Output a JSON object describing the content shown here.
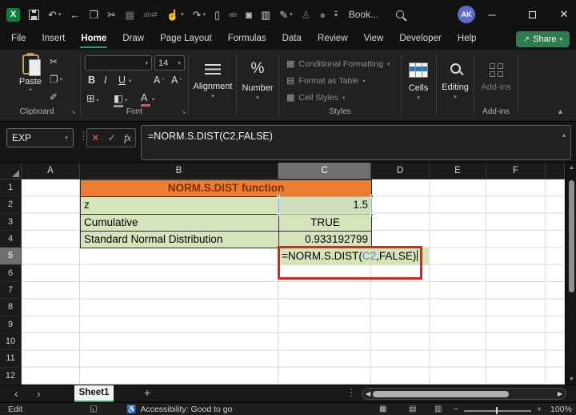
{
  "titlebar": {
    "title": "Book...",
    "avatar": "AK",
    "qat": [
      {
        "name": "excel-logo",
        "type": "logo"
      },
      {
        "name": "save-icon",
        "type": "floppy"
      },
      {
        "name": "undo-icon",
        "glyph": "↶",
        "chev": true
      },
      {
        "name": "back-icon",
        "glyph": "←"
      },
      {
        "name": "copy-icon",
        "glyph": "❐"
      },
      {
        "name": "cut-icon",
        "glyph": "✂"
      },
      {
        "name": "picture-icon",
        "glyph": "▦",
        "muted": true
      },
      {
        "name": "find-replace-icon",
        "glyph": "ab⇄",
        "muted": true,
        "small": true
      },
      {
        "name": "touch-mode-icon",
        "glyph": "☝",
        "chev": true
      },
      {
        "name": "redo-icon",
        "glyph": "↷",
        "chev": true
      },
      {
        "name": "new-file-icon",
        "glyph": "▯"
      },
      {
        "name": "strikethrough-icon",
        "glyph": "ab",
        "muted": true,
        "small": true,
        "strike": true
      },
      {
        "name": "camera-icon",
        "glyph": "◙"
      },
      {
        "name": "doc-preview-icon",
        "glyph": "▥"
      },
      {
        "name": "ink-pen-icon",
        "glyph": "✎",
        "chev": true
      },
      {
        "name": "permissions-icon",
        "glyph": "♙",
        "muted": true
      },
      {
        "name": "shape-circle-icon",
        "glyph": "●",
        "muted": true
      },
      {
        "name": "qat-overflow-icon",
        "glyph": "▾",
        "bar": true
      }
    ],
    "close_glyph": "✕",
    "minimize_glyph": "─"
  },
  "tabs": {
    "items": [
      "File",
      "Insert",
      "Home",
      "Draw",
      "Page Layout",
      "Formulas",
      "Data",
      "Review",
      "View",
      "Developer",
      "Help"
    ],
    "active": "Home",
    "share_label": "Share"
  },
  "ribbon": {
    "paste_label": "Paste",
    "clipboard_group": "Clipboard",
    "font_group": "Font",
    "font_size": "14",
    "bold": "B",
    "italic": "I",
    "underline": "U",
    "alignment_label": "Alignment",
    "number_label": "Number",
    "number_glyph": "%",
    "styles": {
      "group": "Styles",
      "items": [
        {
          "label": "Conditional Formatting",
          "glyph": "▦"
        },
        {
          "label": "Format as Table",
          "glyph": "▤"
        },
        {
          "label": "Cell Styles",
          "glyph": "▩"
        }
      ]
    },
    "cells_label": "Cells",
    "editing_label": "Editing",
    "addins_label": "Add-ins",
    "addins_group": "Add-ins"
  },
  "formula_bar": {
    "name_box": "EXP",
    "cancel": "✕",
    "enter": "✓",
    "insert_function": "fx",
    "formula": "=NORM.S.DIST(C2,FALSE)"
  },
  "grid": {
    "columns": [
      "A",
      "B",
      "C",
      "D",
      "E",
      "F"
    ],
    "rows": [
      "1",
      "2",
      "3",
      "4",
      "5",
      "6",
      "7",
      "8",
      "9",
      "10",
      "11",
      "12"
    ],
    "selected_column": "C",
    "selected_row": "5",
    "title_cell": "NORM.S.DIST function",
    "b2": "z",
    "c2": "1.5",
    "b3": "Cumulative",
    "c3": "TRUE",
    "b4": "Standard Normal Distribution",
    "c4": "0.933192799",
    "c5_prefix": "=NORM.S.DIST(",
    "c5_ref": "C2",
    "c5_suffix": ",FALSE)"
  },
  "sheet_bar": {
    "tab": "Sheet1",
    "add": "+"
  },
  "status_bar": {
    "mode": "Edit",
    "accessibility": "Accessibility: Good to go",
    "zoom_level": "100%"
  },
  "colors": {
    "accent_green": "#21a366",
    "share_green": "#2e7d4f",
    "orange": "#ed7d31",
    "orange_text": "#7a3009",
    "cell_green": "#d6e4bc",
    "ref_blue": "#2e75b6",
    "formula_ref_blue": "#4f86c6",
    "annotation_red": "#e0211c",
    "avatar_blue": "#5b6dc9"
  }
}
